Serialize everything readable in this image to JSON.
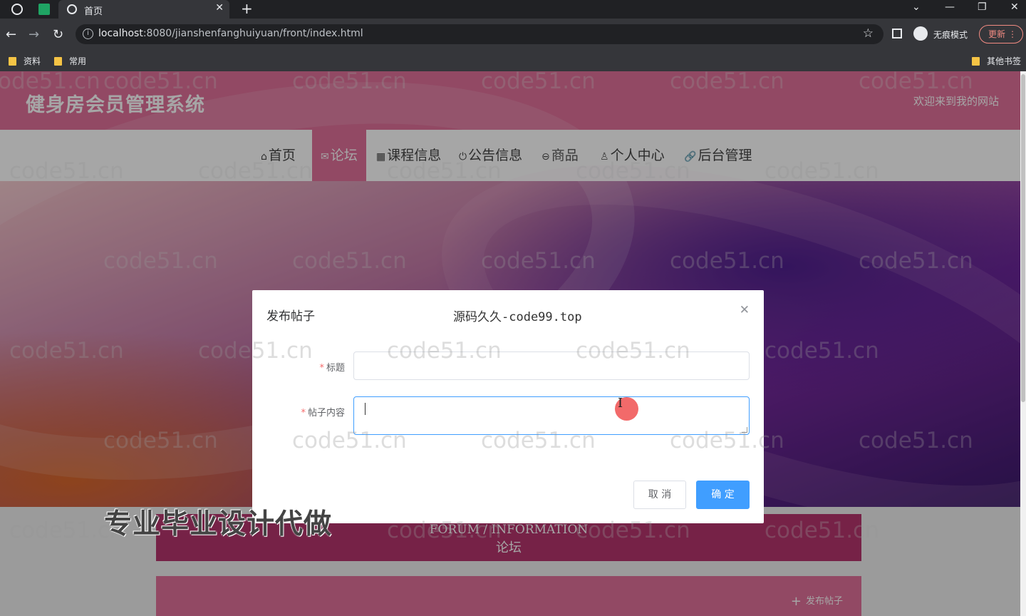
{
  "browser": {
    "tab_title": "首页",
    "url_host": "localhost",
    "url_path": ":8080/jianshenfanghuiyuan/front/index.html",
    "incognito_label": "无痕模式",
    "update_label": "更新",
    "bookmarks": [
      "资料",
      "常用"
    ],
    "other_bookmarks": "其他书签"
  },
  "site": {
    "title": "健身房会员管理系统",
    "welcome": "欢迎来到我的网站",
    "nav": [
      {
        "icon": "⌂",
        "label": "首页"
      },
      {
        "icon": "✉",
        "label": "论坛"
      },
      {
        "icon": "▦",
        "label": "课程信息"
      },
      {
        "icon": "⏻",
        "label": "公告信息"
      },
      {
        "icon": "⊖",
        "label": "商品"
      },
      {
        "icon": "♙",
        "label": "个人中心"
      },
      {
        "icon": "🔗",
        "label": "后台管理"
      }
    ],
    "active_nav": "论坛",
    "forum_en": "FORUM / INFORMATION",
    "forum_cn": "论坛",
    "post_button": "发布帖子"
  },
  "dialog": {
    "title": "发布帖子",
    "fields": [
      {
        "label": "标题",
        "required": true,
        "value": ""
      },
      {
        "label": "帖子内容",
        "required": true,
        "value": ""
      }
    ],
    "cancel": "取 消",
    "ok": "确 定"
  },
  "overlay": {
    "watermark": "code51.cn",
    "source_text": "源码久久-code99.top",
    "promo": "专业毕业设计代做"
  },
  "colors": {
    "brand": "#e0719a",
    "primary": "#409eff",
    "forum_head": "#b5356e"
  }
}
